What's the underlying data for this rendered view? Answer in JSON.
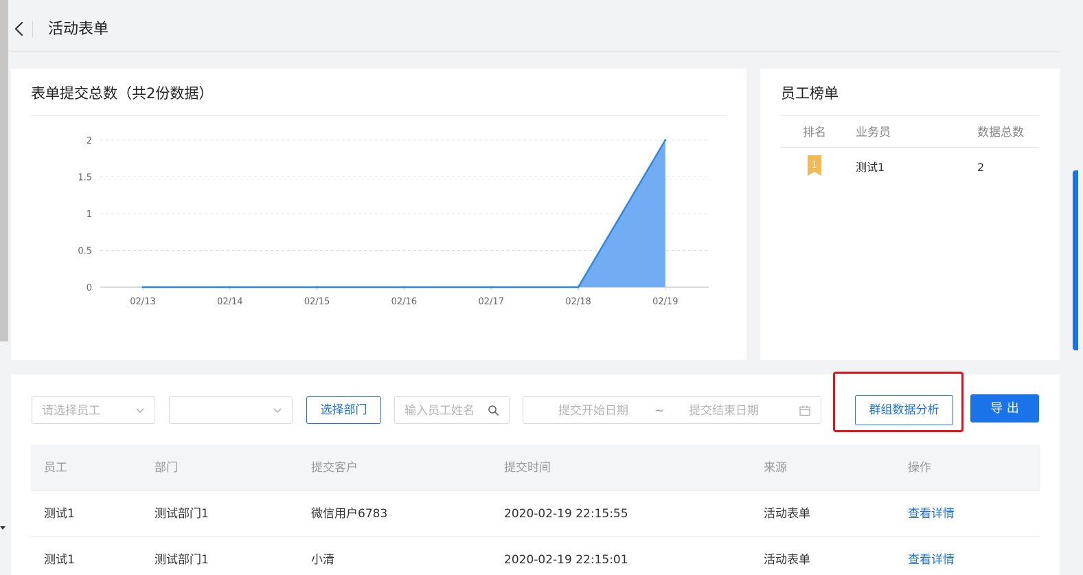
{
  "header": {
    "title": "活动表单"
  },
  "chart_card": {
    "title": "表单提交总数（共2份数据）"
  },
  "chart_data": {
    "type": "area",
    "x": [
      "02/13",
      "02/14",
      "02/15",
      "02/16",
      "02/17",
      "02/18",
      "02/19"
    ],
    "series": [
      {
        "values": [
          0,
          0,
          0,
          0,
          0,
          0,
          2
        ]
      }
    ],
    "yticks": [
      "0",
      "0.5",
      "1",
      "1.5",
      "2"
    ],
    "ylim": [
      0,
      2
    ],
    "grid": true,
    "color": "#2b86f0",
    "fill_color": "#6aa9f2"
  },
  "ranking": {
    "title": "员工榜单",
    "headers": {
      "rank": "排名",
      "staff": "业务员",
      "total": "数据总数"
    },
    "rows": [
      {
        "rank": "1",
        "staff": "测试1",
        "total": "2"
      }
    ],
    "medal_color": "#f2b957"
  },
  "filters": {
    "employee_placeholder": "请选择员工",
    "second_select_value": "",
    "dept_button": "选择部门",
    "name_placeholder": "输入员工姓名",
    "start_date_placeholder": "提交开始日期",
    "range_sep": "~",
    "end_date_placeholder": "提交结束日期",
    "group_analysis_button": "群组数据分析",
    "export_button": "导 出"
  },
  "table": {
    "columns": [
      "员工",
      "部门",
      "提交客户",
      "提交时间",
      "来源",
      "操作"
    ],
    "rows": [
      {
        "employee": "测试1",
        "dept": "测试部门1",
        "customer": "微信用户6783",
        "time": "2020-02-19 22:15:55",
        "source": "活动表单",
        "action": "查看详情"
      },
      {
        "employee": "测试1",
        "dept": "测试部门1",
        "customer": "小清",
        "time": "2020-02-19 22:15:01",
        "source": "活动表单",
        "action": "查看详情"
      }
    ]
  },
  "colors": {
    "accent": "#1a73e8",
    "highlight": "#e8131a"
  }
}
